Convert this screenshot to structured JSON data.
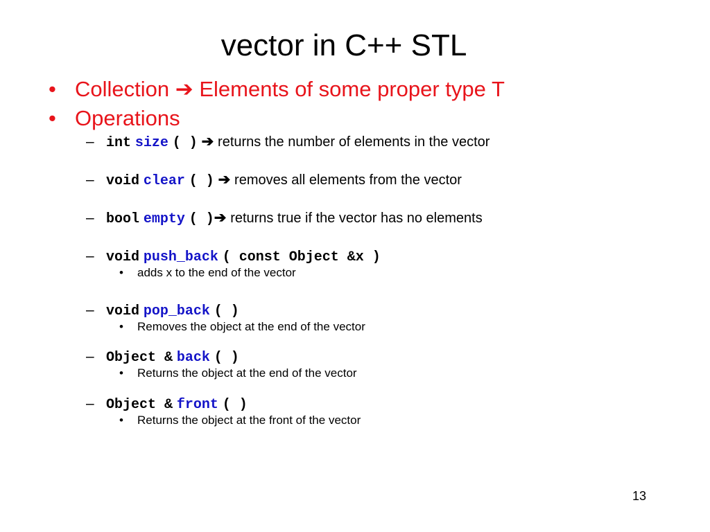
{
  "slide": {
    "title": "vector in C++ STL",
    "page_number": "13",
    "bullets": [
      {
        "bullet": "•",
        "text_before": "Collection",
        "arrow": "➔",
        "text_after": "Elements of some proper type T"
      },
      {
        "bullet": "•",
        "text": "Operations"
      }
    ],
    "operations": [
      {
        "dash": "–",
        "return_type": "int",
        "name": "size",
        "params": "( )",
        "arrow": "➔",
        "description": "returns the number of elements in the vector"
      },
      {
        "dash": "–",
        "return_type": "void",
        "name": "clear",
        "params": "( )",
        "arrow": "➔",
        "description": "removes all elements from the vector"
      },
      {
        "dash": "–",
        "return_type": "bool",
        "name": "empty",
        "params": "( )",
        "arrow": "➔",
        "description": "returns true if the vector has no elements"
      },
      {
        "dash": "–",
        "return_type": "void",
        "name": "push_back",
        "params": "( const Object &x )",
        "sub": {
          "bullet": "•",
          "text": "adds x to the end of the vector"
        }
      },
      {
        "dash": "–",
        "return_type": "void",
        "name": "pop_back",
        "params": "( )",
        "sub": {
          "bullet": "•",
          "text": "Removes the object at the end of the vector"
        }
      },
      {
        "dash": "–",
        "return_type": "Object &",
        "name": "back",
        "params": "( )",
        "sub": {
          "bullet": "•",
          "text": "Returns the object at the end of the vector"
        }
      },
      {
        "dash": "–",
        "return_type": "Object &",
        "name": "front",
        "params": "( )",
        "sub": {
          "bullet": "•",
          "text": "Returns the object at the front of the vector"
        }
      }
    ],
    "colors": {
      "heading_red": "#e8141b",
      "function_blue": "#1414c8",
      "text": "#000000"
    }
  }
}
